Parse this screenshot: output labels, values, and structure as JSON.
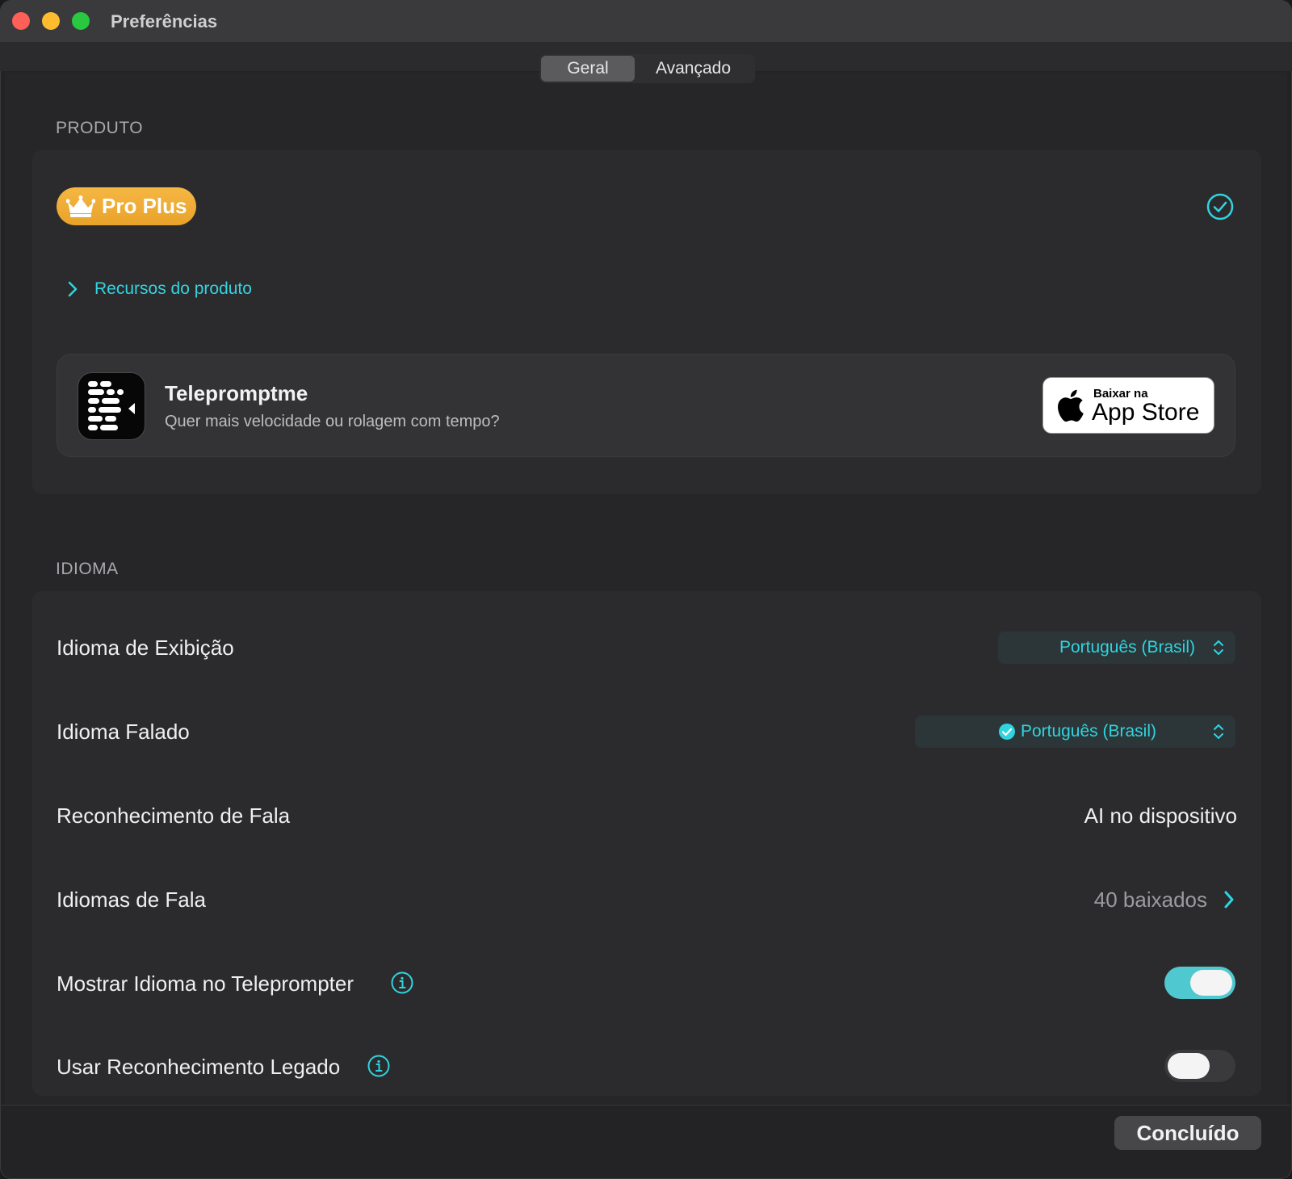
{
  "window": {
    "title": "Preferências"
  },
  "tabs": [
    {
      "label": "Geral",
      "active": true
    },
    {
      "label": "Avançado",
      "active": false
    }
  ],
  "product": {
    "section_label": "PRODUTO",
    "badge_label": "Pro Plus",
    "badge_icon": "crown-icon",
    "status_icon": "checkmark-circle-icon",
    "features_link": "Recursos do produto",
    "promo": {
      "app_name": "Telepromptme",
      "subtitle": "Quer mais velocidade ou rolagem com tempo?",
      "store_small": "Baixar na",
      "store_big": "App Store"
    }
  },
  "language": {
    "section_label": "IDIOMA",
    "rows": [
      {
        "label": "Idioma de Exibição",
        "value": "Português (Brasil)"
      },
      {
        "label": "Idioma Falado",
        "value": "Português (Brasil)"
      },
      {
        "label": "Reconhecimento de Fala",
        "value": "AI no dispositivo"
      },
      {
        "label": "Idiomas de Fala",
        "value": "40 baixados"
      },
      {
        "label": "Mostrar Idioma no Teleprompter",
        "toggle_on": true
      },
      {
        "label": "Usar Reconhecimento Legado",
        "toggle_on": false
      }
    ]
  },
  "footer": {
    "done_label": "Concluído"
  },
  "colors": {
    "accent": "#2fd4df",
    "badge": "#f0ad35",
    "toggle_on": "#4fc9cf"
  }
}
